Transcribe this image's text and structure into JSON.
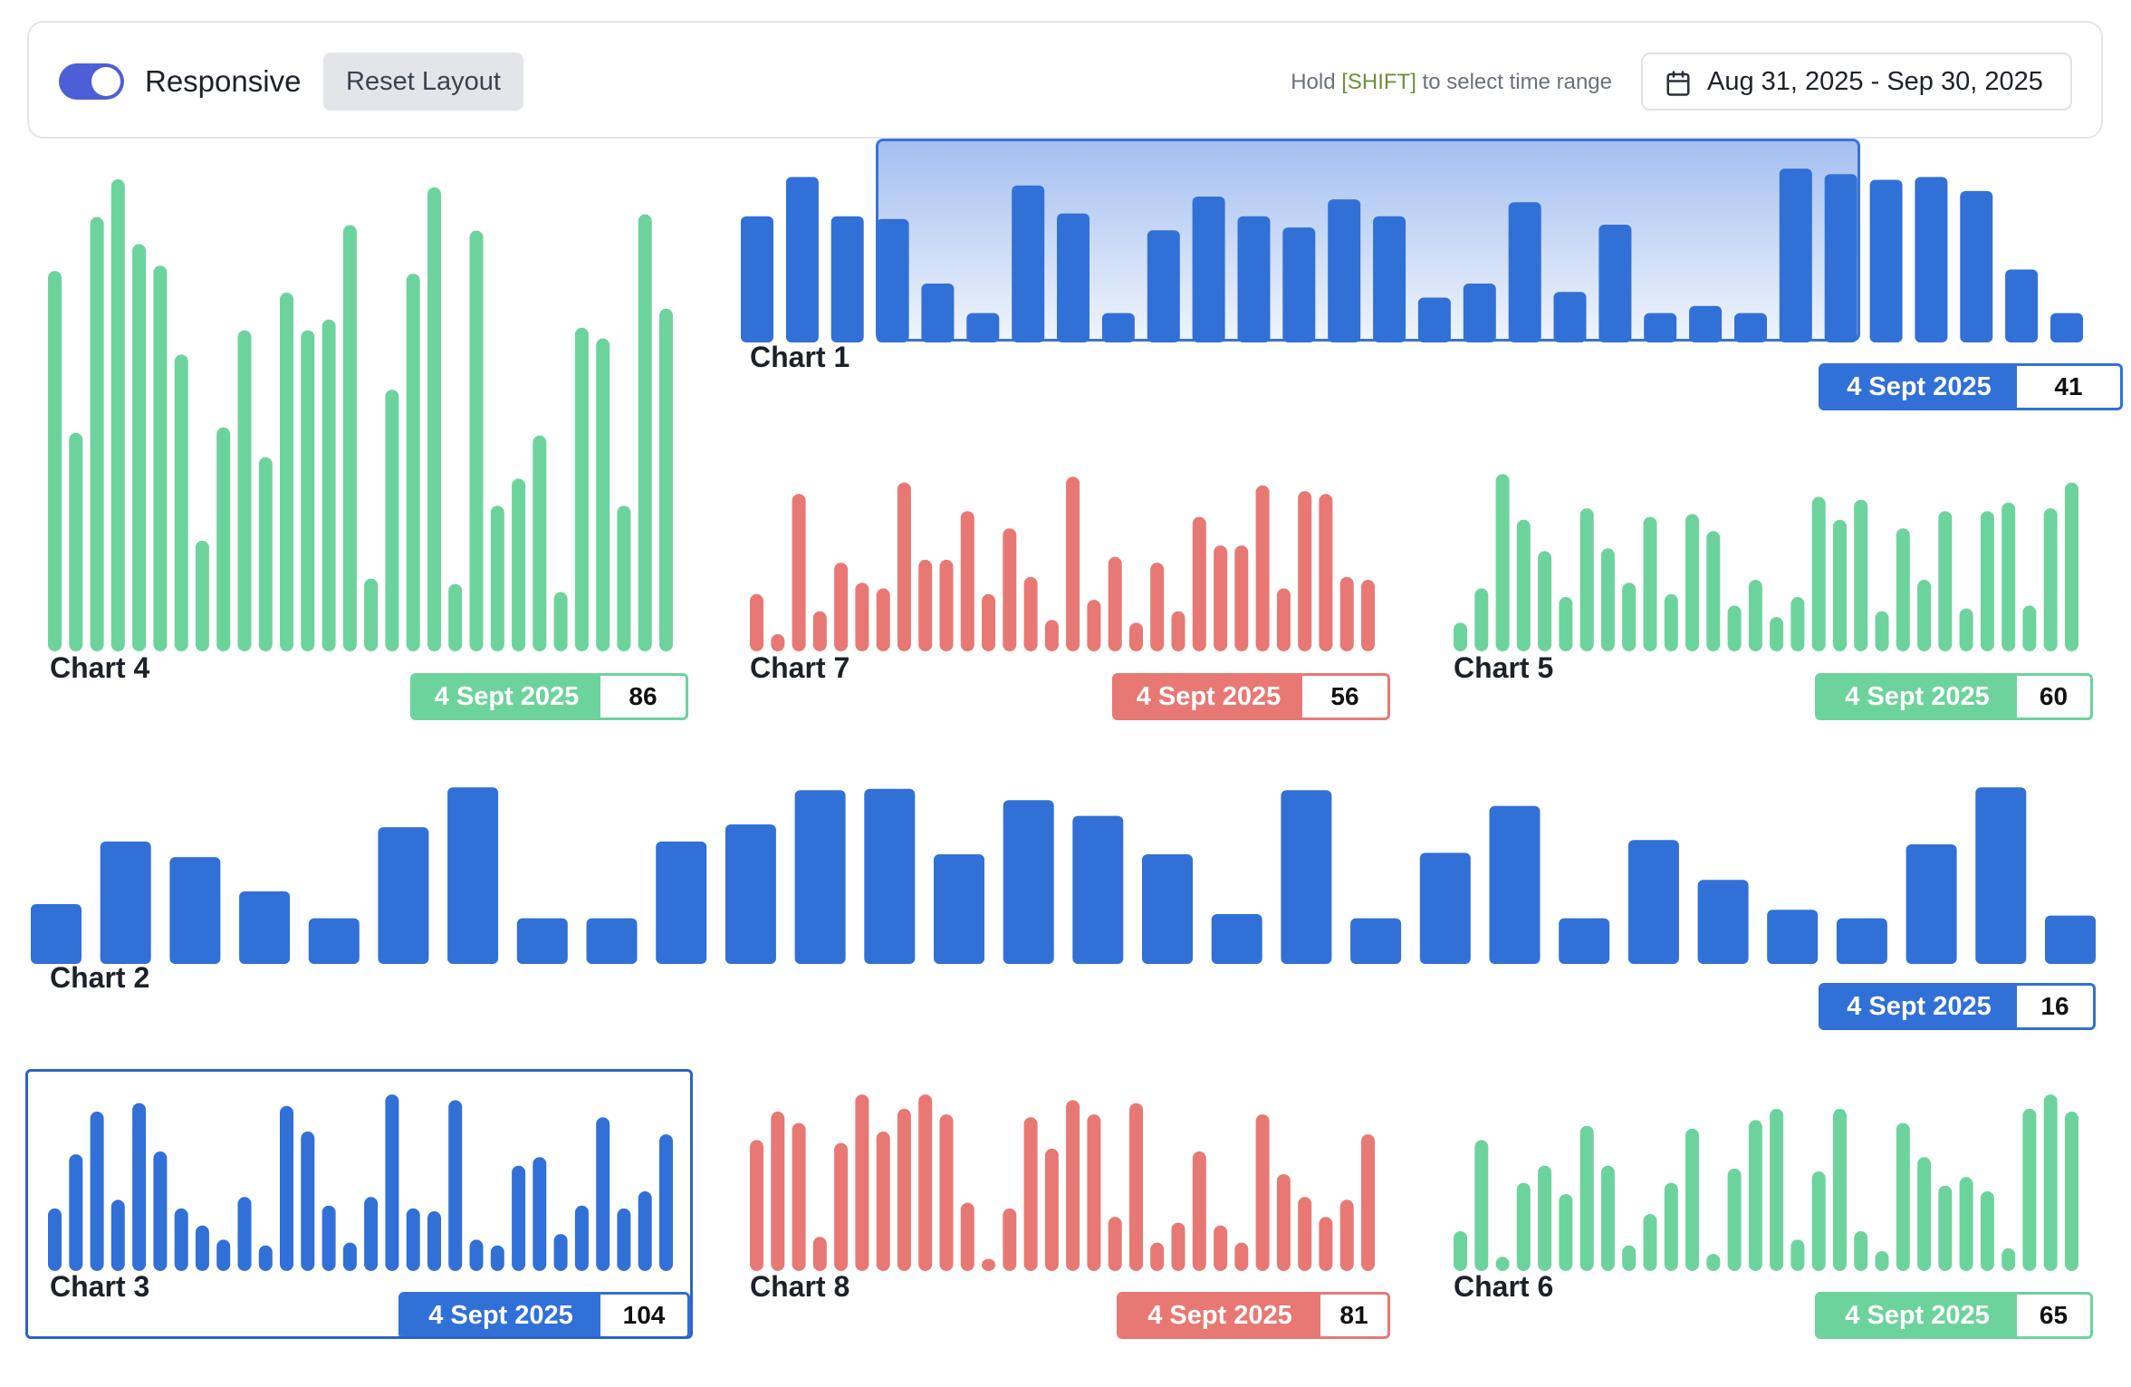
{
  "toolbar": {
    "toggle_label": "Responsive",
    "toggle_on": true,
    "reset_label": "Reset Layout",
    "hint_before": "Hold ",
    "hint_key": "[SHIFT]",
    "hint_after": " to select time range",
    "date_range": "Aug 31, 2025 - Sep 30, 2025",
    "calendar_icon": "calendar-icon"
  },
  "colors": {
    "blue": "#3170d6",
    "green": "#6dd39d",
    "red": "#e87873"
  },
  "chart_data": [
    {
      "id": "chart-1",
      "type": "bar",
      "title": "Chart 1",
      "color": "blue",
      "badge_date": "4 Sept 2025",
      "badge_value": "41",
      "values": [
        90,
        118,
        90,
        88,
        42,
        18,
        112,
        92,
        10,
        80,
        104,
        90,
        82,
        102,
        90,
        32,
        42,
        100,
        36,
        84,
        10,
        26,
        20,
        124,
        120,
        116,
        118,
        108,
        52,
        14
      ],
      "selection": "brush over bars 4-25"
    },
    {
      "id": "chart-4",
      "type": "bar",
      "title": "Chart 4",
      "color": "green",
      "badge_date": "4 Sept 2025",
      "badge_value": "86",
      "values": [
        282,
        162,
        322,
        350,
        302,
        286,
        220,
        82,
        166,
        238,
        144,
        266,
        238,
        246,
        316,
        54,
        194,
        280,
        344,
        50,
        312,
        108,
        128,
        160,
        44,
        240,
        232,
        108,
        324,
        254
      ]
    },
    {
      "id": "chart-7",
      "type": "bar",
      "title": "Chart 7",
      "color": "red",
      "badge_date": "4 Sept 2025",
      "badge_value": "56",
      "values": [
        40,
        12,
        110,
        28,
        62,
        48,
        44,
        118,
        64,
        64,
        98,
        40,
        86,
        52,
        22,
        122,
        36,
        66,
        20,
        62,
        28,
        94,
        74,
        74,
        116,
        44,
        112,
        110,
        52,
        50
      ]
    },
    {
      "id": "chart-5",
      "type": "bar",
      "title": "Chart 5",
      "color": "green",
      "badge_date": "4 Sept 2025",
      "badge_value": "60",
      "values": [
        20,
        44,
        124,
        92,
        70,
        38,
        100,
        72,
        48,
        94,
        40,
        96,
        84,
        32,
        50,
        24,
        38,
        108,
        92,
        106,
        28,
        86,
        50,
        98,
        30,
        98,
        104,
        32,
        100,
        118
      ]
    },
    {
      "id": "chart-2",
      "type": "bar",
      "title": "Chart 2",
      "color": "blue",
      "badge_date": "4 Sept 2025",
      "badge_value": "16",
      "values": [
        42,
        86,
        75,
        51,
        15,
        96,
        124,
        26,
        15,
        86,
        98,
        122,
        123,
        77,
        115,
        104,
        77,
        35,
        122,
        19,
        78,
        111,
        24,
        87,
        59,
        38,
        13,
        84,
        124,
        34
      ]
    },
    {
      "id": "chart-3",
      "type": "bar",
      "title": "Chart 3",
      "color": "blue",
      "badge_date": "4 Sept 2025",
      "badge_value": "104",
      "values": [
        44,
        82,
        112,
        50,
        118,
        84,
        44,
        32,
        22,
        52,
        18,
        116,
        98,
        46,
        20,
        52,
        124,
        44,
        42,
        120,
        22,
        18,
        74,
        80,
        26,
        46,
        108,
        44,
        56,
        96
      ]
    },
    {
      "id": "chart-8",
      "type": "bar",
      "title": "Chart 8",
      "color": "red",
      "badge_date": "4 Sept 2025",
      "badge_value": "81",
      "values": [
        92,
        112,
        104,
        24,
        90,
        124,
        98,
        114,
        124,
        110,
        48,
        8,
        44,
        108,
        86,
        120,
        110,
        38,
        118,
        20,
        34,
        84,
        32,
        20,
        110,
        68,
        52,
        38,
        50,
        96
      ]
    },
    {
      "id": "chart-6",
      "type": "bar",
      "title": "Chart 6",
      "color": "green",
      "badge_date": "4 Sept 2025",
      "badge_value": "65",
      "values": [
        28,
        92,
        10,
        62,
        74,
        54,
        102,
        74,
        18,
        40,
        62,
        100,
        12,
        72,
        106,
        114,
        22,
        70,
        114,
        28,
        14,
        104,
        80,
        60,
        66,
        56,
        16,
        114,
        124,
        112
      ]
    }
  ]
}
